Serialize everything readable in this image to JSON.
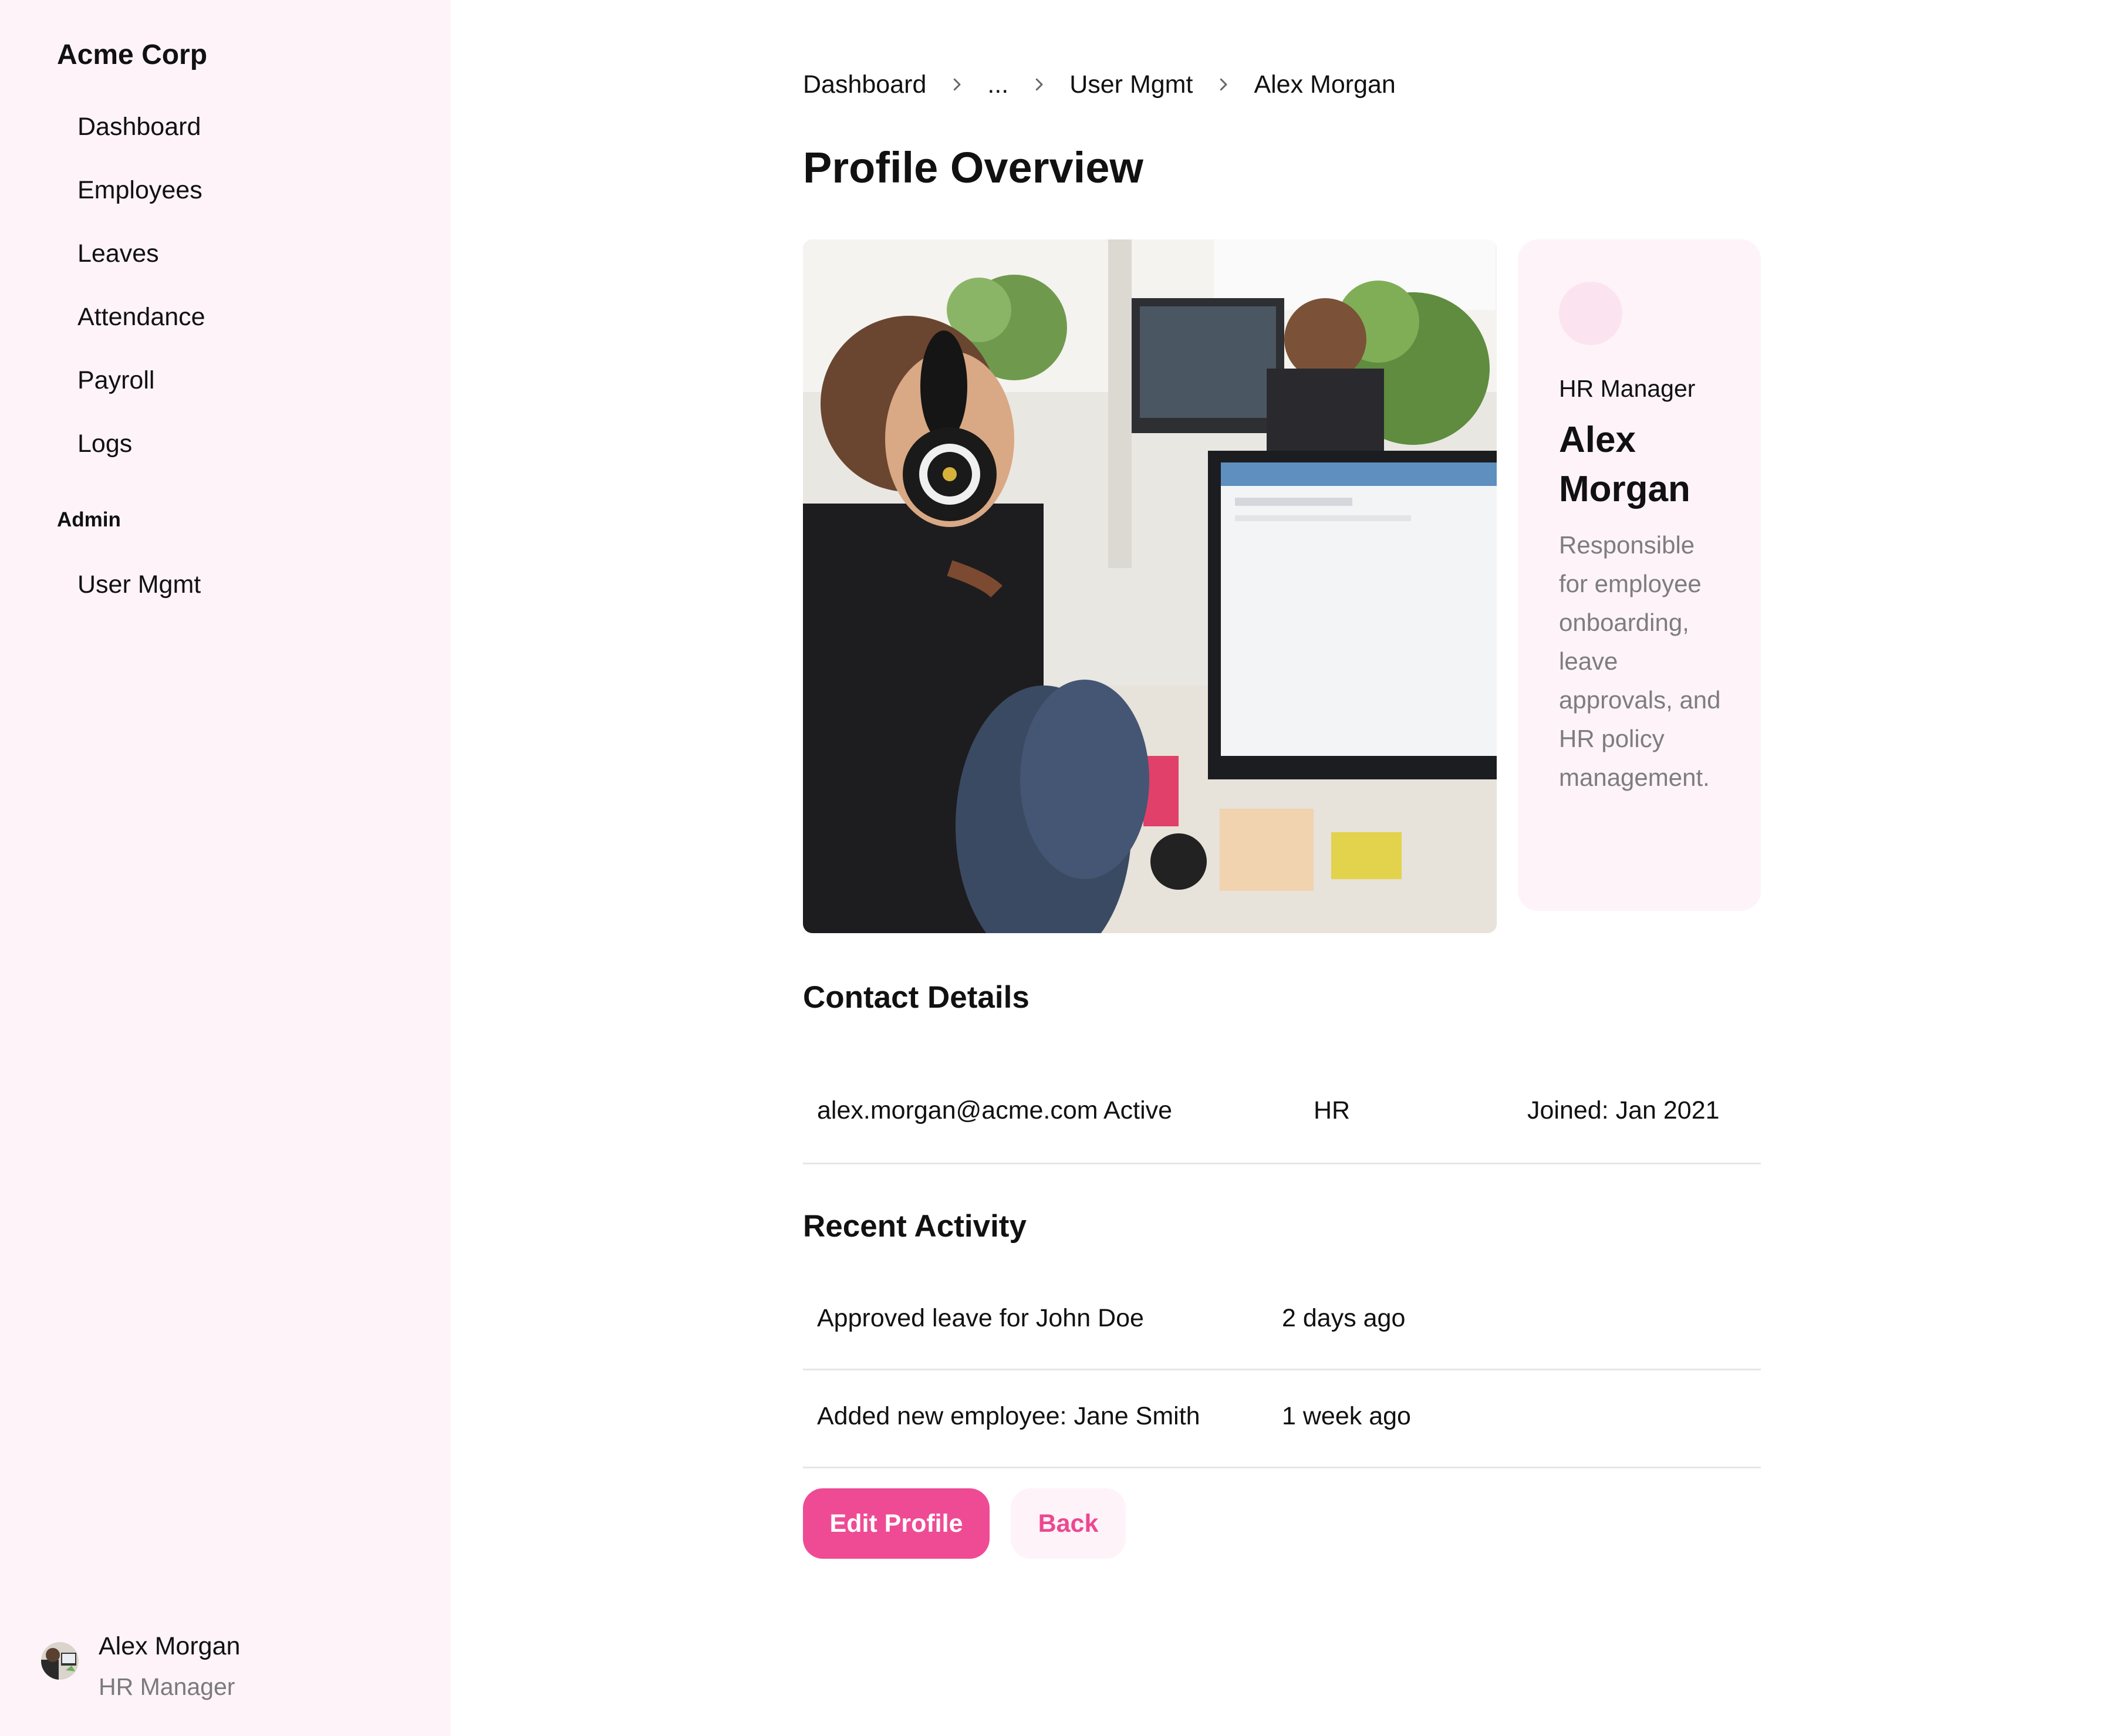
{
  "sidebar": {
    "brand": "Acme Corp",
    "items": [
      {
        "label": "Dashboard",
        "icon": "dashboard-icon"
      },
      {
        "label": "Employees",
        "icon": "users-icon"
      },
      {
        "label": "Leaves",
        "icon": "calendar-icon"
      },
      {
        "label": "Attendance",
        "icon": "clock-icon"
      },
      {
        "label": "Payroll",
        "icon": "wallet-icon"
      },
      {
        "label": "Logs",
        "icon": "file-icon"
      }
    ],
    "section_label": "Admin",
    "admin_items": [
      {
        "label": "User Mgmt",
        "icon": "user-cog-icon"
      }
    ],
    "user": {
      "name": "Alex Morgan",
      "role": "HR Manager"
    }
  },
  "breadcrumb": [
    "Dashboard",
    "...",
    "User Mgmt",
    "Alex Morgan"
  ],
  "page_title": "Profile Overview",
  "profile": {
    "role": "HR Manager",
    "name": "Alex Morgan",
    "description": "Responsible for employee onboarding, leave approvals, and HR policy management."
  },
  "contact": {
    "title": "Contact Details",
    "email": "alex.morgan@acme.com",
    "status": "Active",
    "department": "HR",
    "joined": "Joined: Jan 2021"
  },
  "activity": {
    "title": "Recent Activity",
    "rows": [
      {
        "text": "Approved leave for John Doe",
        "time": "2 days ago"
      },
      {
        "text": "Added new employee: Jane Smith",
        "time": "1 week ago"
      }
    ]
  },
  "actions": {
    "edit_label": "Edit Profile",
    "back_label": "Back"
  },
  "colors": {
    "accent": "#ef4b94",
    "sidebar_bg": "#fdf3f8",
    "muted_text": "#7d7d7d",
    "divider": "#e6e6e6"
  }
}
